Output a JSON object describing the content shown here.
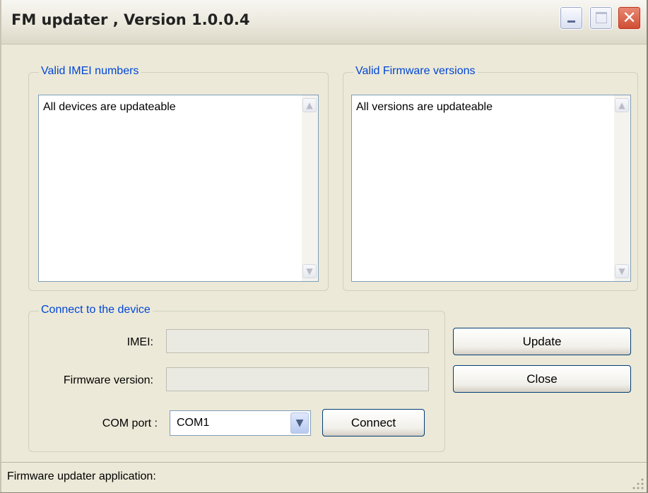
{
  "window": {
    "title": "FM updater , Version 1.0.0.4",
    "close_glyph": "✕"
  },
  "imei_group": {
    "legend": "Valid IMEI numbers",
    "items": [
      "All devices are updateable"
    ]
  },
  "firmware_group": {
    "legend": "Valid Firmware versions",
    "items": [
      "All versions are updateable"
    ]
  },
  "scroll": {
    "up_glyph": "▲",
    "down_glyph": "▼"
  },
  "connect_group": {
    "legend": "Connect to the device",
    "imei_label": "IMEI:",
    "imei_value": "",
    "firmware_label": "Firmware version:",
    "firmware_value": "",
    "com_label": "COM port :",
    "com_value": "COM1",
    "combo_glyph": "▼",
    "connect_button": "Connect"
  },
  "actions": {
    "update_button": "Update",
    "close_button": "Close"
  },
  "statusbar": {
    "text": "Firmware updater application:"
  },
  "icons": [
    "minimize-icon",
    "maximize-icon",
    "close-icon",
    "scroll-up-icon",
    "scroll-down-icon",
    "dropdown-arrow-icon",
    "resize-grip-icon"
  ]
}
